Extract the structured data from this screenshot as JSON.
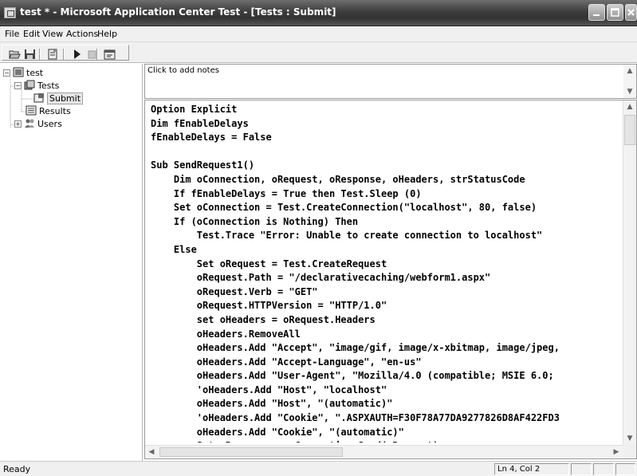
{
  "window": {
    "title": "test * - Microsoft Application Center Test - [Tests : Submit]",
    "minimize_glyph": "_"
  },
  "menu": {
    "file": "File",
    "edit": "Edit",
    "view": "View",
    "actions": "Actions",
    "help": "Help"
  },
  "toolbar": {
    "icons": [
      "open-icon",
      "save-icon",
      "new-test-icon",
      "run-icon",
      "stop-icon",
      "properties-icon"
    ]
  },
  "tree": {
    "root": "test",
    "tests": "Tests",
    "submit": "Submit",
    "results": "Results",
    "users": "Users",
    "collapse_glyph": "−",
    "expand_glyph": "+"
  },
  "notes": {
    "placeholder": "Click to add notes"
  },
  "editor": {
    "lines": [
      "Option Explicit",
      "Dim fEnableDelays",
      "fEnableDelays = False",
      "",
      "Sub SendRequest1()",
      "    Dim oConnection, oRequest, oResponse, oHeaders, strStatusCode",
      "    If fEnableDelays = True then Test.Sleep (0)",
      "    Set oConnection = Test.CreateConnection(\"localhost\", 80, false)",
      "    If (oConnection is Nothing) Then",
      "        Test.Trace \"Error: Unable to create connection to localhost\"",
      "    Else",
      "        Set oRequest = Test.CreateRequest",
      "        oRequest.Path = \"/declarativecaching/webform1.aspx\"",
      "        oRequest.Verb = \"GET\"",
      "        oRequest.HTTPVersion = \"HTTP/1.0\"",
      "        set oHeaders = oRequest.Headers",
      "        oHeaders.RemoveAll",
      "        oHeaders.Add \"Accept\", \"image/gif, image/x-xbitmap, image/jpeg,",
      "        oHeaders.Add \"Accept-Language\", \"en-us\"",
      "        oHeaders.Add \"User-Agent\", \"Mozilla/4.0 (compatible; MSIE 6.0;",
      "        'oHeaders.Add \"Host\", \"localhost\"",
      "        oHeaders.Add \"Host\", \"(automatic)\"",
      "        'oHeaders.Add \"Cookie\", \".ASPXAUTH=F30F78A77DA9277826D8AF422FD3",
      "        oHeaders.Add \"Cookie\", \"(automatic)\"",
      "        Set oResponse = oConnection.Send(oRequest)"
    ]
  },
  "status": {
    "text": "Ready",
    "position": "Ln 4, Col 2"
  }
}
